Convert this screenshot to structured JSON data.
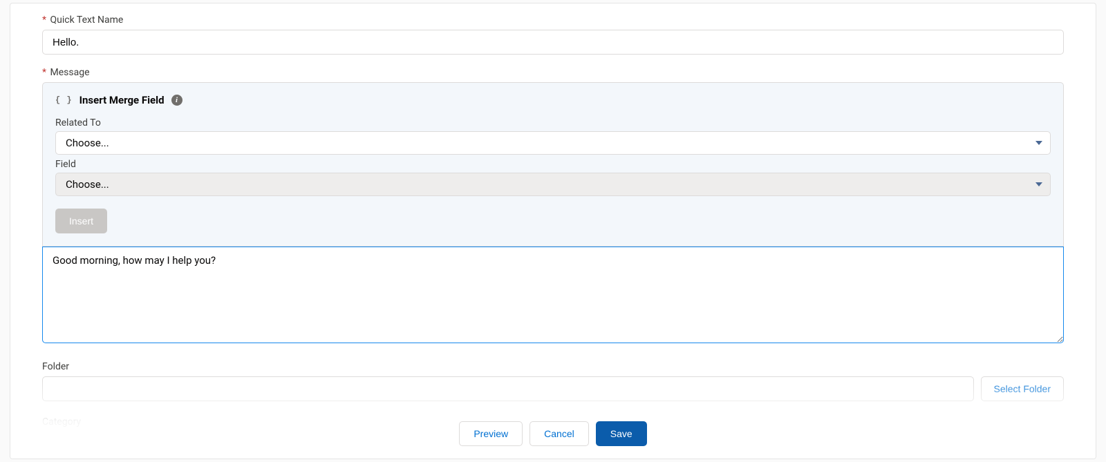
{
  "quick_text_name": {
    "label": "Quick Text Name",
    "value": "Hello."
  },
  "message": {
    "label": "Message",
    "merge_field": {
      "header": "Insert Merge Field",
      "related_to": {
        "label": "Related To",
        "selected": "Choose..."
      },
      "field": {
        "label": "Field",
        "selected": "Choose..."
      },
      "insert_button": "Insert"
    },
    "body": "Good morning, how may I help you?"
  },
  "folder": {
    "label": "Folder",
    "select_button": "Select Folder"
  },
  "category": {
    "label": "Category"
  },
  "footer": {
    "preview": "Preview",
    "cancel": "Cancel",
    "save": "Save"
  }
}
